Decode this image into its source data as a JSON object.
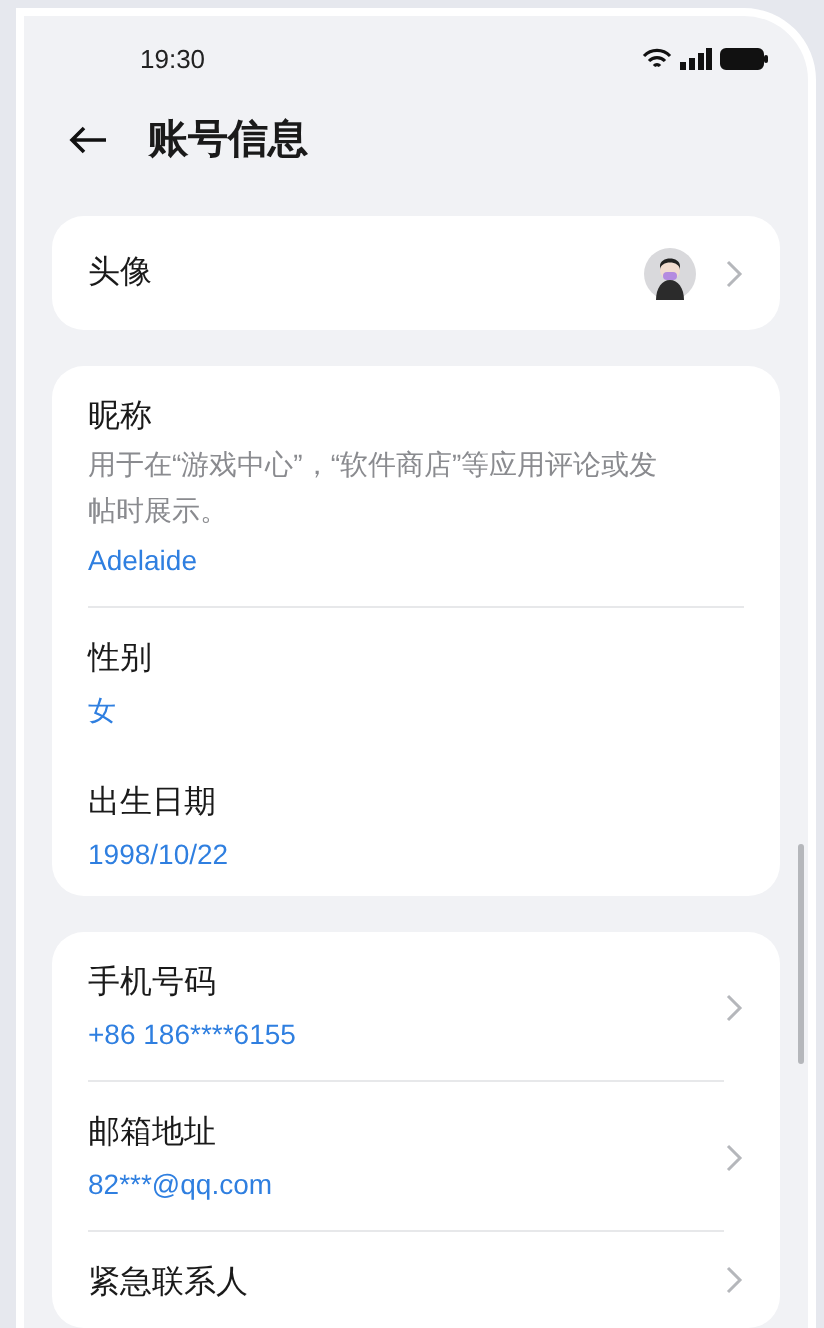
{
  "status_bar": {
    "time": "19:30"
  },
  "header": {
    "title": "账号信息"
  },
  "groups": [
    {
      "items": [
        {
          "kind": "avatar",
          "label": "头像",
          "chevron": true
        }
      ]
    },
    {
      "items": [
        {
          "kind": "field",
          "label": "昵称",
          "description": "用于在“游戏中心”，“软件商店”等应用评论或发帖时展示。",
          "value": "Adelaide",
          "chevron": false
        },
        {
          "kind": "field",
          "label": "性别",
          "value": "女",
          "chevron": false
        },
        {
          "kind": "field",
          "label": "出生日期",
          "value": "1998/10/22",
          "chevron": false
        }
      ]
    },
    {
      "items": [
        {
          "kind": "field",
          "label": "手机号码",
          "value": "+86 186****6155",
          "chevron": true
        },
        {
          "kind": "field",
          "label": "邮箱地址",
          "value": "82***@qq.com",
          "chevron": true
        },
        {
          "kind": "field",
          "label": "紧急联系人",
          "chevron": true
        }
      ]
    }
  ]
}
